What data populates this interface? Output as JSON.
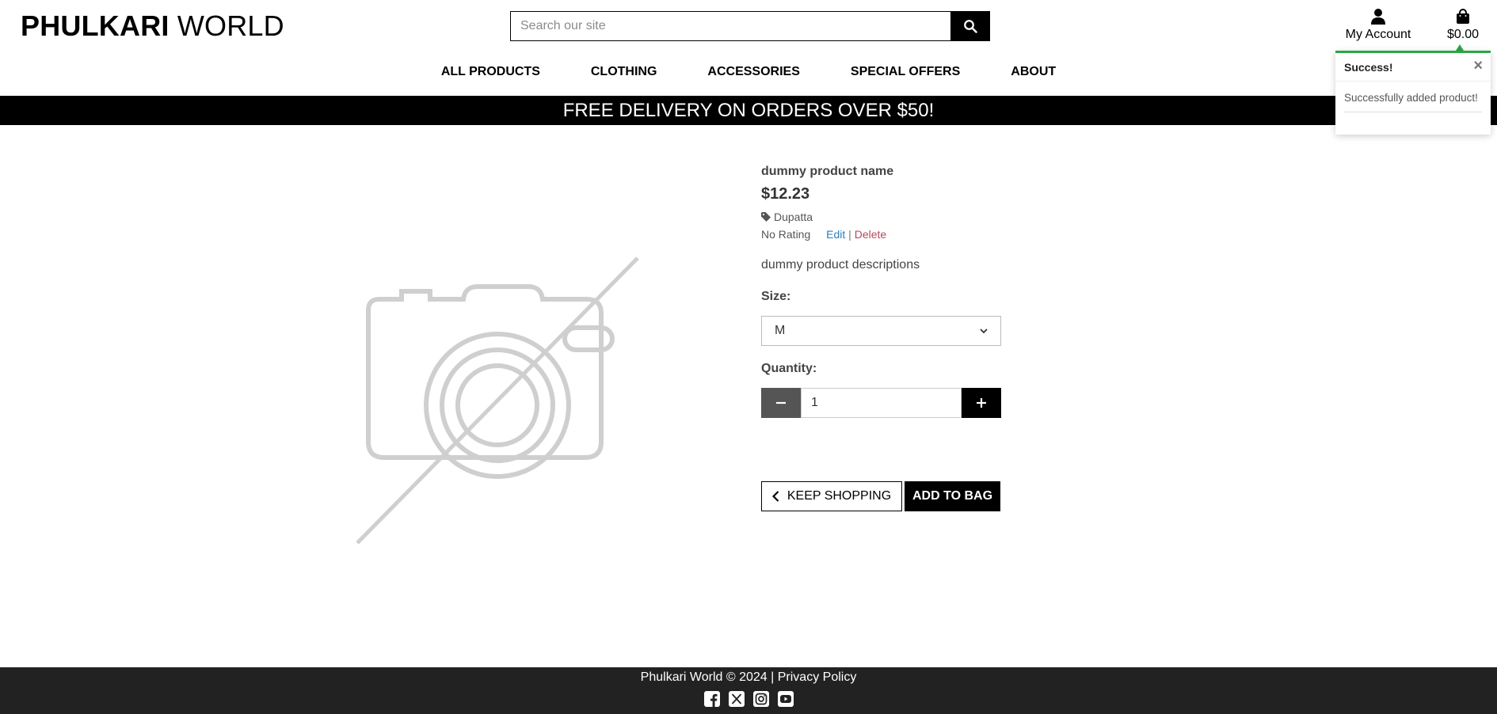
{
  "header": {
    "brand_bold": "PHULKARI",
    "brand_rest": "WORLD",
    "search_placeholder": "Search our site",
    "account_label": "My Account",
    "bag_total": "$0.00"
  },
  "nav": {
    "items": [
      "ALL PRODUCTS",
      "CLOTHING",
      "ACCESSORIES",
      "SPECIAL OFFERS",
      "ABOUT"
    ]
  },
  "banner": {
    "text": "FREE DELIVERY ON ORDERS OVER $50!"
  },
  "toast": {
    "title": "Success!",
    "message": "Successfully added product!",
    "accent": "#28a745"
  },
  "product": {
    "name": "dummy product name",
    "price": "$12.23",
    "category": "Dupatta",
    "rating": "No Rating",
    "edit_label": "Edit",
    "separator": "|",
    "delete_label": "Delete",
    "description": "dummy product descriptions",
    "size_label": "Size:",
    "size_value": "M",
    "quantity_label": "Quantity:",
    "quantity_value": "1",
    "keep_shopping_label": "KEEP SHOPPING",
    "add_to_bag_label": "ADD TO BAG"
  },
  "footer": {
    "copyright": "Phulkari World © 2024 |",
    "privacy_label": "Privacy Policy",
    "socials": [
      "facebook-icon",
      "x-twitter-icon",
      "instagram-icon",
      "youtube-icon"
    ]
  }
}
